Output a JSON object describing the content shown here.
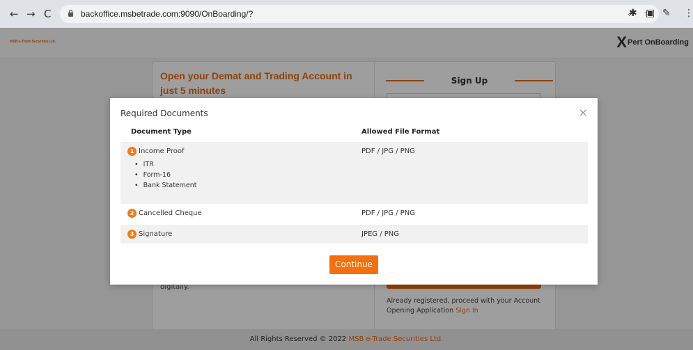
{
  "browser": {
    "url": "backoffice.msbetrade.com:9090/OnBoarding/?"
  },
  "header": {
    "brand": "MSB e-Trade Securities Ltd.",
    "product_mark": "X",
    "product_name": "Pert OnBoarding"
  },
  "page": {
    "headline": "Open your Demat and Trading Account in just 5 minutes",
    "signup_title": "Sign Up",
    "digitally_text": "digitally.",
    "already_text": "Already registered, proceed with your Account Opening Application",
    "sign_in_link": "Sign In"
  },
  "footer": {
    "text": "All Rights Reserved © 2022",
    "company": "MSB e-Trade Securities Ltd."
  },
  "modal": {
    "title": "Required Documents",
    "close_symbol": "×",
    "col_doc": "Document Type",
    "col_format": "Allowed File Format",
    "rows": [
      {
        "num": "1",
        "name": "Income Proof",
        "format": "PDF / JPG / PNG",
        "subitems": [
          "ITR",
          "Form-16",
          "Bank Statement"
        ]
      },
      {
        "num": "2",
        "name": "Cancelled Cheque",
        "format": "PDF / JPG / PNG"
      },
      {
        "num": "3",
        "name": "Signature",
        "format": "JPEG / PNG"
      }
    ],
    "continue_label": "Continue"
  },
  "colors": {
    "accent": "#e86a10",
    "button": "#f46f0e"
  }
}
